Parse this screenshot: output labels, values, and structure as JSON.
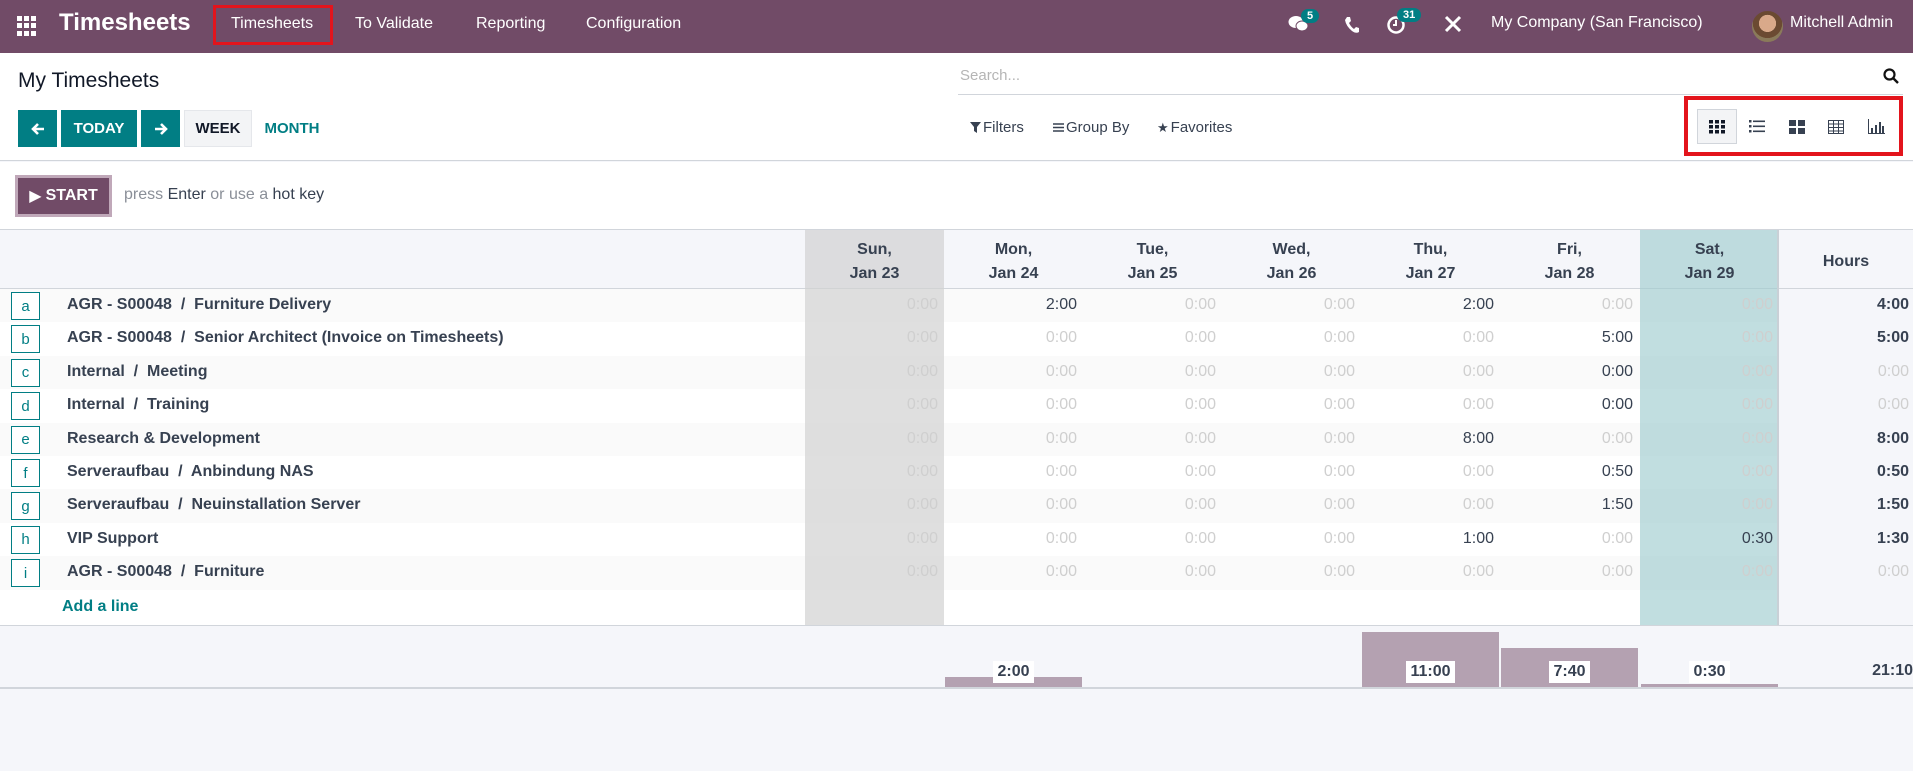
{
  "navbar": {
    "app_name": "Timesheets",
    "menu": [
      "Timesheets",
      "To Validate",
      "Reporting",
      "Configuration"
    ],
    "messages_count": "5",
    "activities_count": "31",
    "company": "My Company (San Francisco)",
    "user": "Mitchell Admin"
  },
  "control_panel": {
    "title": "My Timesheets",
    "today_label": "TODAY",
    "week_label": "WEEK",
    "month_label": "MONTH",
    "search_placeholder": "Search...",
    "filters_label": "Filters",
    "groupby_label": "Group By",
    "favorites_label": "Favorites",
    "views": [
      "grid",
      "list",
      "kanban",
      "pivot",
      "graph"
    ],
    "active_view": "grid"
  },
  "start": {
    "label": "START",
    "hint_1": "press ",
    "hint_key": "Enter",
    "hint_2": " or use a ",
    "hint_hot": "hot key"
  },
  "grid": {
    "columns": [
      {
        "day": "Sun,",
        "date": "Jan 23"
      },
      {
        "day": "Mon,",
        "date": "Jan 24"
      },
      {
        "day": "Tue,",
        "date": "Jan 25"
      },
      {
        "day": "Wed,",
        "date": "Jan 26"
      },
      {
        "day": "Thu,",
        "date": "Jan 27"
      },
      {
        "day": "Fri,",
        "date": "Jan 28"
      },
      {
        "day": "Sat,",
        "date": "Jan 29"
      }
    ],
    "hours_label": "Hours",
    "rows": [
      {
        "key": "a",
        "label": "AGR - S00048  /  Furniture Delivery",
        "values": [
          "0:00",
          "2:00",
          "0:00",
          "0:00",
          "2:00",
          "0:00",
          "0:00"
        ],
        "total": "4:00"
      },
      {
        "key": "b",
        "label": "AGR - S00048  /  Senior Architect (Invoice on Timesheets)",
        "values": [
          "0:00",
          "0:00",
          "0:00",
          "0:00",
          "0:00",
          "5:00",
          "0:00"
        ],
        "total": "5:00"
      },
      {
        "key": "c",
        "label": "Internal  /  Meeting",
        "values": [
          "0:00",
          "0:00",
          "0:00",
          "0:00",
          "0:00",
          "0:00*",
          "0:00"
        ],
        "total": "0:00"
      },
      {
        "key": "d",
        "label": "Internal  /  Training",
        "values": [
          "0:00",
          "0:00",
          "0:00",
          "0:00",
          "0:00",
          "0:00*",
          "0:00"
        ],
        "total": "0:00"
      },
      {
        "key": "e",
        "label": "Research & Development",
        "values": [
          "0:00",
          "0:00",
          "0:00",
          "0:00",
          "8:00",
          "0:00",
          "0:00"
        ],
        "total": "8:00"
      },
      {
        "key": "f",
        "label": "Serveraufbau  /  Anbindung NAS",
        "values": [
          "0:00",
          "0:00",
          "0:00",
          "0:00",
          "0:00",
          "0:50",
          "0:00"
        ],
        "total": "0:50"
      },
      {
        "key": "g",
        "label": "Serveraufbau  /  Neuinstallation Server",
        "values": [
          "0:00",
          "0:00",
          "0:00",
          "0:00",
          "0:00",
          "1:50",
          "0:00"
        ],
        "total": "1:50"
      },
      {
        "key": "h",
        "label": "VIP Support",
        "values": [
          "0:00",
          "0:00",
          "0:00",
          "0:00",
          "1:00",
          "0:00",
          "0:30"
        ],
        "total": "1:30"
      },
      {
        "key": "i",
        "label": "AGR - S00048  /  Furniture",
        "values": [
          "0:00",
          "0:00",
          "0:00",
          "0:00",
          "0:00",
          "0:00",
          "0:00"
        ],
        "total": "0:00"
      }
    ],
    "add_line_label": "Add a line",
    "daily_totals": [
      "",
      "2:00",
      "",
      "",
      "11:00",
      "7:40",
      "0:30"
    ],
    "daily_totals_hours": [
      0,
      2,
      0,
      0,
      11,
      7.6667,
      0.5
    ],
    "grand_total": "21:10"
  },
  "colors": {
    "brand": "#714B67",
    "accent": "#017E84",
    "today_column": "#bddfe0",
    "weekend_column": "#e0e0e0",
    "bar": "#b4a1b1",
    "highlight_box": "#e3141c"
  }
}
